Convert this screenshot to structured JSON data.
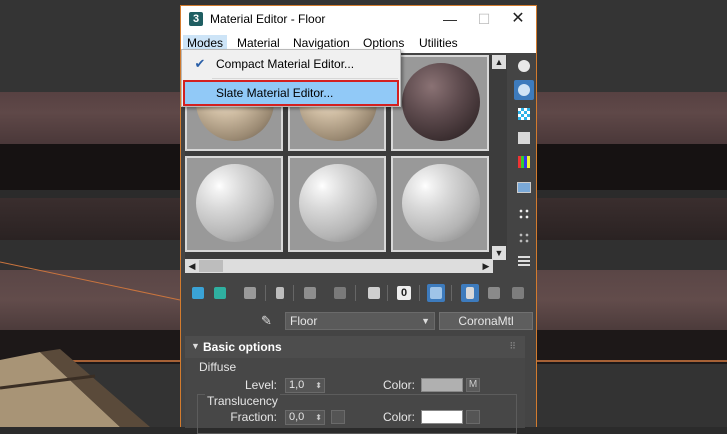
{
  "window": {
    "title": "Material Editor - Floor",
    "app_icon": "3",
    "controls": {
      "minimize": "—",
      "maximize": "☐",
      "close": "✕"
    }
  },
  "menubar": {
    "items": [
      {
        "label": "Modes"
      },
      {
        "label": "Material"
      },
      {
        "label": "Navigation"
      },
      {
        "label": "Options"
      },
      {
        "label": "Utilities"
      }
    ]
  },
  "modes_menu": {
    "items": [
      {
        "label": "Compact Material Editor...",
        "checked": true
      },
      {
        "label": "Slate Material Editor...",
        "highlighted": true
      }
    ],
    "check_glyph": "✔"
  },
  "sample_slots": {
    "rows": [
      [
        "wood",
        "wood",
        "dark"
      ],
      [
        "white",
        "white",
        "white"
      ]
    ]
  },
  "scroll": {
    "up": "▲",
    "down": "▼",
    "left": "◀",
    "right": "▶"
  },
  "side_toolbar": {
    "icons": [
      "sample-type-sphere-icon",
      "backlight-icon",
      "background-checker-icon",
      "sample-uv-tiling-icon",
      "video-color-check-icon",
      "make-preview-icon",
      "options-icon",
      "select-by-material-icon",
      "material-map-navigator-icon"
    ]
  },
  "bottom_toolbar": {
    "icons": [
      "get-material-icon",
      "put-to-scene-icon",
      "assign-to-selection-icon",
      "reset-map-icon",
      "make-copy-icon",
      "make-unique-icon",
      "put-to-library-icon",
      "material-id-channel-icon",
      "show-shaded-icon",
      "show-end-result-icon",
      "go-to-parent-icon",
      "go-forward-sibling-icon"
    ],
    "material_id": "0"
  },
  "name_row": {
    "eyedropper": "✎",
    "material_name": "Floor",
    "dropdown_arrow": "▼",
    "material_type": "CoronaMtl"
  },
  "rollout": {
    "title": "Basic options",
    "toggle": "▼",
    "grip": "⠿",
    "diffuse": {
      "group_label": "Diffuse",
      "level_label": "Level:",
      "level_value": "1,0",
      "color_label": "Color:",
      "color": "#b0b0b0",
      "map_button": "M"
    },
    "translucency": {
      "group_label": "Translucency",
      "fraction_label": "Fraction:",
      "fraction_value": "0,0",
      "color_label": "Color:",
      "color": "#ffffff"
    },
    "spinner_glyph": "⬍"
  },
  "colors": {
    "window_border": "#d27b2e",
    "highlight_outline": "#d32020",
    "menu_highlight": "#91c9f7",
    "active_button": "#3d7bbd"
  }
}
